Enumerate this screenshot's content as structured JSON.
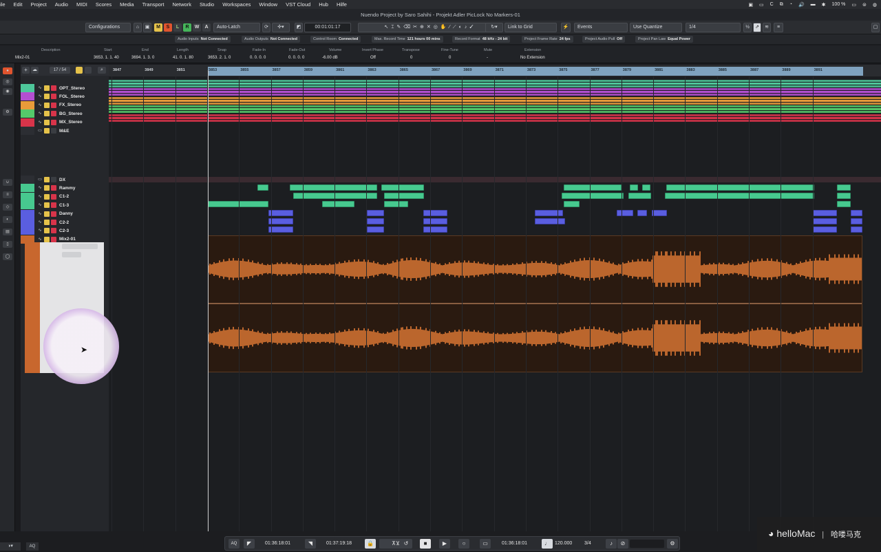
{
  "menubar": {
    "items": [
      "ile",
      "Edit",
      "Project",
      "Audio",
      "MIDI",
      "Scores",
      "Media",
      "Transport",
      "Network",
      "Studio",
      "Workspaces",
      "Window",
      "VST Cloud",
      "Hub",
      "Hilfe"
    ],
    "battery": "100 %"
  },
  "window": {
    "title": "Nuendo Project by Saro Sahihi - Projekt Adler PicLock No Markers-01"
  },
  "toolbar": {
    "configurations": "Configurations",
    "automation_mode": "Auto-Latch",
    "time_display": "00:01:01:17",
    "link_mode": "Link to Grid",
    "events": "Events",
    "quantize_mode": "Use Quantize",
    "quantize_value": "1/4",
    "mute_label": "M",
    "solo_label": "S",
    "listen_label": "L",
    "read_label": "R",
    "write_label": "W",
    "a_label": "A"
  },
  "status": [
    {
      "label": "Audio Inputs",
      "value": "Not Connected"
    },
    {
      "label": "Audio Outputs",
      "value": "Not Connected"
    },
    {
      "label": "Control Room",
      "value": "Connected"
    },
    {
      "label": "Max. Record Time",
      "value": "121 hours 00 mins"
    },
    {
      "label": "Record Format",
      "value": "48 kHz - 24 bit"
    },
    {
      "label": "Project Frame Rate",
      "value": "24 fps"
    },
    {
      "label": "Project Audio Pull",
      "value": "Off"
    },
    {
      "label": "Project Pan Law",
      "value": "Equal Power"
    }
  ],
  "infoline": {
    "name": "Mix2-01",
    "fields": [
      {
        "label": "Description",
        "value": ""
      },
      {
        "label": "Start",
        "value": "3653. 1. 1. 40"
      },
      {
        "label": "End",
        "value": "3694. 1. 3. 0"
      },
      {
        "label": "Length",
        "value": "41. 0. 1. 80"
      },
      {
        "label": "Snap",
        "value": "3653. 2. 1. 0"
      },
      {
        "label": "Fade-In",
        "value": "0. 0. 0. 0"
      },
      {
        "label": "Fade-Out",
        "value": "0. 0. 0. 0"
      },
      {
        "label": "Volume",
        "value": "-6.00 dB"
      },
      {
        "label": "Invert Phase",
        "value": "Off"
      },
      {
        "label": "Transpose",
        "value": "0"
      },
      {
        "label": "Fine-Tune",
        "value": "0"
      },
      {
        "label": "Mute",
        "value": "-"
      },
      {
        "label": "Extension",
        "value": "No Extension"
      }
    ]
  },
  "tracklist": {
    "counter": "17 / 54",
    "upper_tracks": [
      {
        "name": "OPT_Stereo",
        "color": "#4ec79a"
      },
      {
        "name": "FOL_Stereo",
        "color": "#b44fd1"
      },
      {
        "name": "FX_Stereo",
        "color": "#e89b3a"
      },
      {
        "name": "BG_Stereo",
        "color": "#55c96a"
      },
      {
        "name": "MX_Stereo",
        "color": "#d8344a"
      },
      {
        "name": "M&E",
        "color": "#8c8f95"
      }
    ],
    "lower_tracks": [
      {
        "name": "DX",
        "color": "#8c8f95"
      },
      {
        "name": "Rammy",
        "color": "#47c98f"
      },
      {
        "name": "C1-2",
        "color": "#47c98f"
      },
      {
        "name": "C1-3",
        "color": "#47c98f"
      },
      {
        "name": "Danny",
        "color": "#5a5ee0"
      },
      {
        "name": "C2-2",
        "color": "#5a5ee0"
      },
      {
        "name": "C2-3",
        "color": "#5a5ee0"
      },
      {
        "name": "Mix2-01",
        "color": "#c8672e"
      }
    ]
  },
  "ruler": {
    "bars": [
      "3847",
      "3849",
      "3851",
      "3853",
      "3855",
      "3857",
      "3859",
      "3861",
      "3863",
      "3865",
      "3867",
      "3869",
      "3871",
      "3873",
      "3875",
      "3877",
      "3879",
      "3881",
      "3883",
      "3885",
      "3887",
      "3889",
      "3891"
    ]
  },
  "transport": {
    "left_locator": "01:36:18:01",
    "right_locator": "01:37:19:18",
    "primary_time": "01:36:18:01",
    "tempo": "120.000",
    "signature": "3/4"
  },
  "watermark": {
    "brand": "helloMac",
    "chinese": "哈喽马克"
  },
  "colors": {
    "dx_green": "#47c98f",
    "dx_blue": "#5a5ee0",
    "mix_orange": "#c8672e",
    "accent_selection": "#7fa2bf"
  }
}
